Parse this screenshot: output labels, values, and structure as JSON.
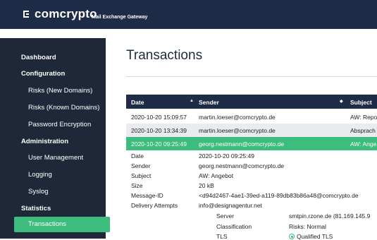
{
  "header": {
    "brand": "comcrypto",
    "subtitle": "Mail Exchange Gateway"
  },
  "sidebar": {
    "items": [
      {
        "label": "Dashboard",
        "type": "heading"
      },
      {
        "label": "Configuration",
        "type": "heading"
      },
      {
        "label": "Risks (New Domains)",
        "type": "item"
      },
      {
        "label": "Risks (Known Domains)",
        "type": "item"
      },
      {
        "label": "Password Encryption",
        "type": "item"
      },
      {
        "label": "Administration",
        "type": "heading"
      },
      {
        "label": "User Management",
        "type": "item"
      },
      {
        "label": "Logging",
        "type": "item"
      },
      {
        "label": "Syslog",
        "type": "item"
      },
      {
        "label": "Statistics",
        "type": "heading"
      },
      {
        "label": "Transactions",
        "type": "item",
        "active": true
      }
    ]
  },
  "page": {
    "title": "Transactions"
  },
  "table": {
    "columns": [
      "Date",
      "Sender",
      "Subject"
    ],
    "rows": [
      {
        "date": "2020-10-20 15:09:57",
        "sender": "martin.loeser@comcrypto.de",
        "subject": "AW: Repo"
      },
      {
        "date": "2020-10-20 13:34:39",
        "sender": "martin.loeser@comcrypto.de",
        "subject": "Absprach"
      },
      {
        "date": "2020-10-20 09:25:49",
        "sender": "georg.nestmann@comcrypto.de",
        "subject": "AW: Ange"
      }
    ]
  },
  "details": {
    "fields": [
      {
        "label": "Date",
        "value": "2020-10-20 09:25:49"
      },
      {
        "label": "Sender",
        "value": "georg.nestmann@comcrypto.de"
      },
      {
        "label": "Subject",
        "value": "AW: Angebot"
      },
      {
        "label": "Size",
        "value": "20 kB"
      },
      {
        "label": "Message-ID",
        "value": "<d94d2467-4ae1-39ed-a119-89db83b86a48@comcrypto.de"
      },
      {
        "label": "Delivery Attempts",
        "value": "info@designagentur.net"
      }
    ],
    "attempt": [
      {
        "label": "Server",
        "value": "smtpin.rzone.de (81.169.145.9"
      },
      {
        "label": "Classification",
        "value": "Risks: Normal"
      },
      {
        "label": "TLS",
        "value": "Qualified TLS"
      }
    ]
  },
  "colors": {
    "topbar": "#1e2c47",
    "sidebar": "#1f2838",
    "accent": "#3dbd7d"
  }
}
